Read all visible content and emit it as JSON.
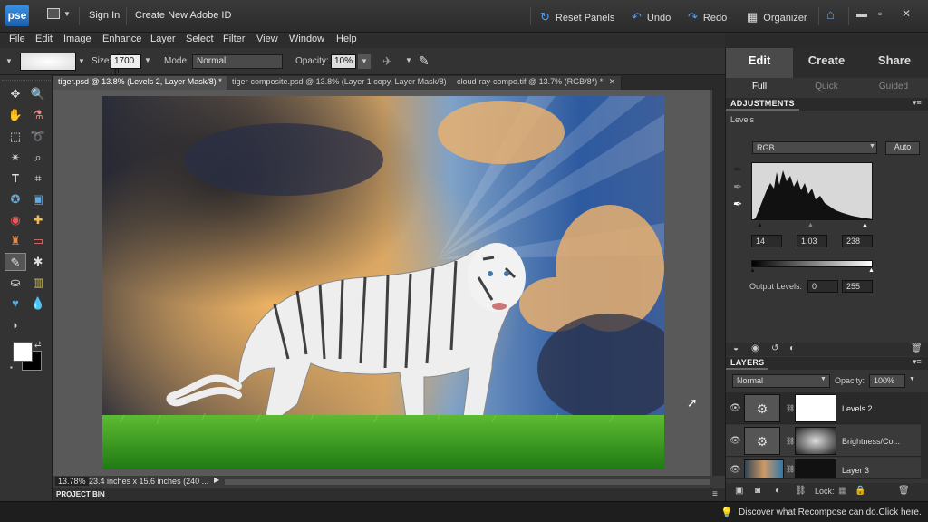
{
  "app": {
    "logo": "pse",
    "sign_in": "Sign In",
    "create_id": "Create New Adobe ID"
  },
  "titlebar": {
    "reset_panels": "Reset Panels",
    "undo": "Undo",
    "redo": "Redo",
    "organizer": "Organizer"
  },
  "menu": [
    "File",
    "Edit",
    "Image",
    "Enhance",
    "Layer",
    "Select",
    "Filter",
    "View",
    "Window",
    "Help"
  ],
  "options": {
    "size_label": "Size:",
    "size_value": "1700 p",
    "mode_label": "Mode:",
    "mode_value": "Normal",
    "opacity_label": "Opacity:",
    "opacity_value": "10%"
  },
  "doc_tabs": [
    {
      "label": "tiger.psd @ 13.8% (Levels 2, Layer Mask/8) *"
    },
    {
      "label": "tiger-composite.psd @ 13.8% (Layer 1 copy, Layer Mask/8)"
    },
    {
      "label": "cloud-ray-compo.tif @ 13.7% (RGB/8*) *"
    }
  ],
  "status": {
    "zoom": "13.78%",
    "doc_size": "23.4 inches x 15.6 inches (240 ..."
  },
  "project_bin": "PROJECT BIN",
  "modes": {
    "edit": "Edit",
    "create": "Create",
    "share": "Share",
    "full": "Full",
    "quick": "Quick",
    "guided": "Guided"
  },
  "adjustments": {
    "header": "ADJUSTMENTS",
    "title": "Levels",
    "channel": "RGB",
    "auto": "Auto",
    "input_black": "14",
    "input_gamma": "1.03",
    "input_white": "238",
    "output_label": "Output Levels:",
    "output_black": "0",
    "output_white": "255"
  },
  "layers": {
    "header": "LAYERS",
    "blend": "Normal",
    "opacity_label": "Opacity:",
    "opacity_value": "100%",
    "lock_label": "Lock:",
    "items": [
      {
        "name": "Levels 2"
      },
      {
        "name": "Brightness/Co..."
      },
      {
        "name": "Layer 3"
      }
    ]
  },
  "hint": "Discover what Recompose can do.Click here."
}
